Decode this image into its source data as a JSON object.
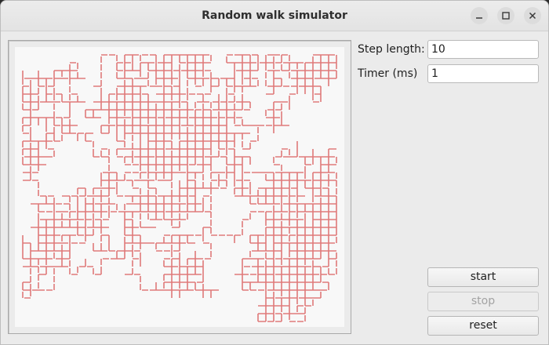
{
  "window": {
    "title": "Random walk simulator"
  },
  "controls": {
    "step_length": {
      "label": "Step length:",
      "value": "10"
    },
    "timer": {
      "label": "Timer (ms)",
      "value": "1"
    }
  },
  "buttons": {
    "start": "start",
    "stop": "stop",
    "reset": "reset"
  },
  "colors": {
    "walk_trace": "#e07a7a",
    "canvas_bg": "#f8f8f8"
  },
  "icons": {
    "minimize": "minimize-icon",
    "maximize": "maximize-icon",
    "close": "close-icon"
  }
}
